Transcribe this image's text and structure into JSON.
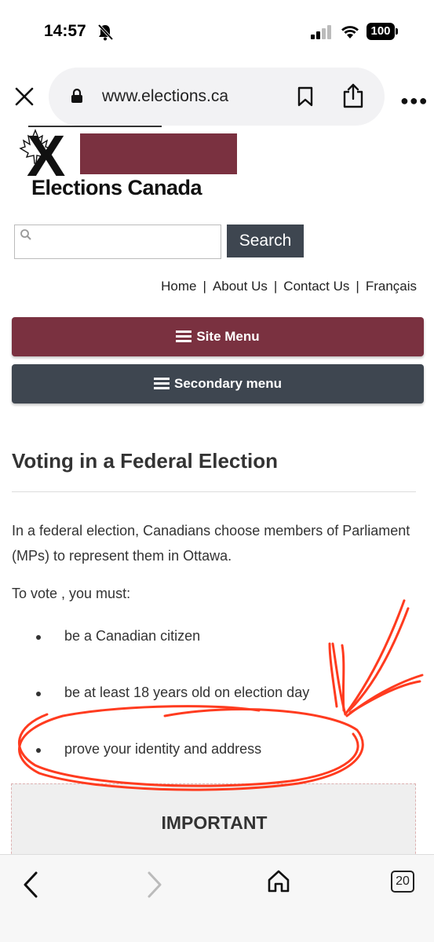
{
  "status_bar": {
    "time": "14:57",
    "battery": "100"
  },
  "browser": {
    "url": "www.elections.ca",
    "tabs_count": "20"
  },
  "logo": {
    "text": "Elections Canada"
  },
  "search": {
    "button_label": "Search",
    "value": ""
  },
  "top_links": [
    "Home",
    "About Us",
    "Contact Us",
    "Français"
  ],
  "menus": {
    "site_menu": "Site Menu",
    "secondary_menu": "Secondary menu"
  },
  "content": {
    "heading": "Voting in a Federal Election",
    "intro": "In a federal election, Canadians choose members of Parliament (MPs) to represent them in Ottawa.",
    "requirements_lead": "To vote , you must:",
    "requirements": [
      "be a Canadian citizen",
      "be at least 18 years old on election day",
      "prove your identity and address"
    ],
    "important_title": "IMPORTANT"
  },
  "colors": {
    "brand_maroon": "#7a3140",
    "dark_slate": "#3e4650",
    "annotation_red": "#ff3b1f"
  },
  "icons": [
    "close-icon",
    "lock-icon",
    "bookmark-icon",
    "share-icon",
    "more-icon",
    "search-icon",
    "menu-icon",
    "back-icon",
    "forward-icon",
    "home-icon",
    "tabs-icon",
    "silent-bell-icon",
    "signal-icon",
    "wifi-icon",
    "battery-icon"
  ]
}
